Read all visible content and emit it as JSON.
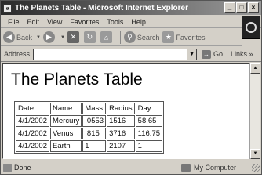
{
  "window": {
    "title": "The Planets Table - Microsoft Internet Explorer",
    "app_icon_glyph": "e",
    "controls": {
      "minimize": "_",
      "maximize": "□",
      "close": "×"
    }
  },
  "menu": [
    "File",
    "Edit",
    "View",
    "Favorites",
    "Tools",
    "Help"
  ],
  "toolbar": {
    "back_label": "Back",
    "search_label": "Search",
    "favorites_label": "Favorites",
    "icons": [
      "back-arrow-icon",
      "forward-arrow-icon",
      "stop-icon",
      "refresh-icon",
      "home-icon",
      "search-icon",
      "favorites-icon"
    ]
  },
  "address": {
    "label": "Address",
    "value": "",
    "go_label": "Go",
    "links_label": "Links »"
  },
  "page": {
    "heading": "The Planets Table",
    "table": {
      "headers": [
        "Date",
        "Name",
        "Mass",
        "Radius",
        "Day"
      ],
      "rows": [
        [
          "4/1/2002",
          "Mercury",
          ".0553",
          "1516",
          "58.65"
        ],
        [
          "4/1/2002",
          "Venus",
          ".815",
          "3716",
          "116.75"
        ],
        [
          "4/1/2002",
          "Earth",
          "1",
          "2107",
          "1"
        ]
      ]
    }
  },
  "status": {
    "text": "Done",
    "zone": "My Computer"
  },
  "colors": {
    "chrome": "#d4d0c8",
    "content_bg": "#ffffff",
    "titlebar_start": "#2a2a2a"
  }
}
